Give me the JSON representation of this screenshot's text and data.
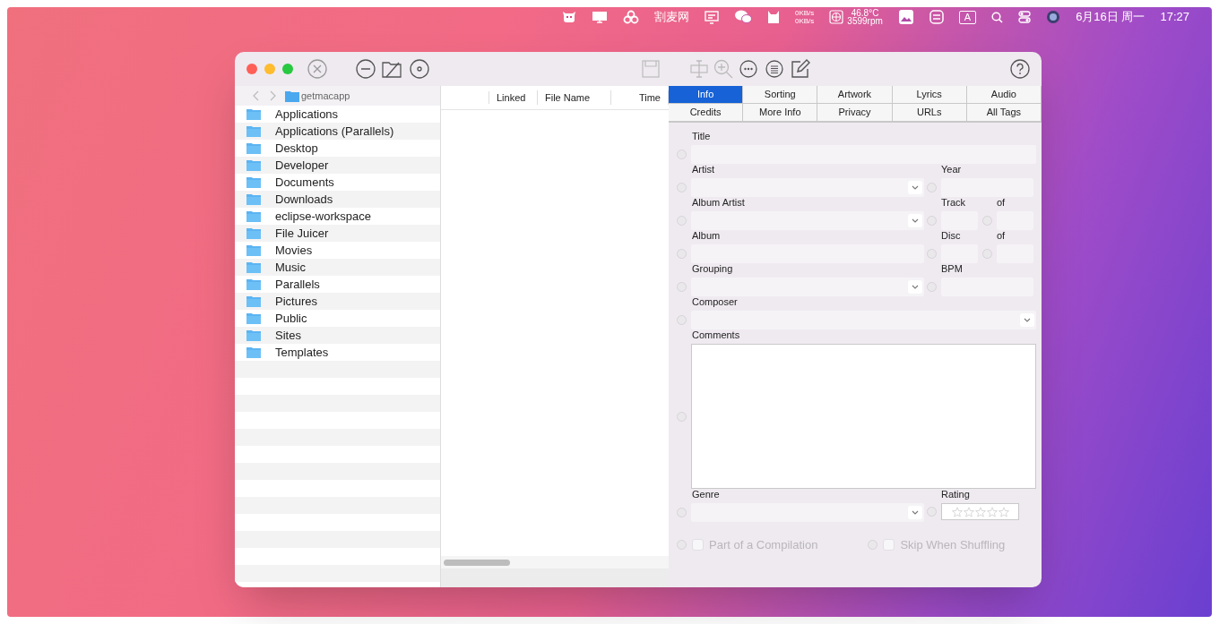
{
  "menu_bar": {
    "items": [
      {
        "kind": "icon"
      },
      {
        "kind": "icon"
      },
      {
        "kind": "icon"
      },
      {
        "kind": "text",
        "text": "割麦网"
      },
      {
        "kind": "icon"
      },
      {
        "kind": "icon"
      },
      {
        "kind": "icon"
      },
      {
        "kind": "stack",
        "lines": [
          "0KB/s",
          "0KB/s"
        ]
      },
      {
        "kind": "fan",
        "lines": [
          "46.8°C",
          "3599rpm"
        ]
      },
      {
        "kind": "icon"
      },
      {
        "kind": "icon"
      },
      {
        "kind": "key",
        "text": "A"
      },
      {
        "kind": "icon"
      },
      {
        "kind": "icon"
      },
      {
        "kind": "icon"
      },
      {
        "kind": "text",
        "text": "6月16日 周一"
      },
      {
        "kind": "text",
        "text": "17:27"
      }
    ]
  },
  "sidebar": {
    "path": "getmacapp",
    "items": [
      {
        "label": "Applications"
      },
      {
        "label": "Applications (Parallels)"
      },
      {
        "label": "Desktop"
      },
      {
        "label": "Developer"
      },
      {
        "label": "Documents"
      },
      {
        "label": "Downloads"
      },
      {
        "label": "eclipse-workspace"
      },
      {
        "label": "File Juicer"
      },
      {
        "label": "Movies"
      },
      {
        "label": "Music"
      },
      {
        "label": "Parallels"
      },
      {
        "label": "Pictures"
      },
      {
        "label": "Public"
      },
      {
        "label": "Sites"
      },
      {
        "label": "Templates"
      }
    ]
  },
  "file_list": {
    "columns": [
      "Linked",
      "File Name",
      "Time"
    ]
  },
  "tabs": [
    {
      "label": "Info",
      "selected": true
    },
    {
      "label": "Sorting",
      "selected": false
    },
    {
      "label": "Artwork",
      "selected": false
    },
    {
      "label": "Lyrics",
      "selected": false
    },
    {
      "label": "Audio",
      "selected": false
    },
    {
      "label": "Credits",
      "selected": false
    },
    {
      "label": "More Info",
      "selected": false
    },
    {
      "label": "Privacy",
      "selected": false
    },
    {
      "label": "URLs",
      "selected": false
    },
    {
      "label": "All Tags",
      "selected": false
    }
  ],
  "form": {
    "rows": [
      {
        "left": {
          "label": "Title",
          "kind": "text"
        }
      },
      {
        "left": {
          "label": "Artist",
          "kind": "combo"
        },
        "right": [
          {
            "label": "Year",
            "kind": "text"
          }
        ]
      },
      {
        "left": {
          "label": "Album Artist",
          "kind": "combo"
        },
        "right": [
          {
            "label": "Track",
            "kind": "short"
          },
          {
            "label": "of",
            "kind": "short"
          }
        ]
      },
      {
        "left": {
          "label": "Album",
          "kind": "text"
        },
        "right": [
          {
            "label": "Disc",
            "kind": "short"
          },
          {
            "label": "of",
            "kind": "short"
          }
        ]
      },
      {
        "left": {
          "label": "Grouping",
          "kind": "combo"
        },
        "right": [
          {
            "label": "BPM",
            "kind": "text"
          }
        ]
      },
      {
        "left": {
          "label": "Composer",
          "kind": "combo"
        }
      },
      {
        "left": {
          "label": "Comments",
          "kind": "area"
        }
      },
      {
        "left": {
          "label": "Genre",
          "kind": "combo"
        },
        "right": [
          {
            "label": "Rating",
            "kind": "stars",
            "stars": 0
          }
        ]
      }
    ],
    "checkboxes": [
      {
        "label": "Part of a Compilation",
        "checked": false,
        "disabled": true
      },
      {
        "label": "Skip When Shuffling",
        "checked": false,
        "disabled": true
      }
    ]
  }
}
